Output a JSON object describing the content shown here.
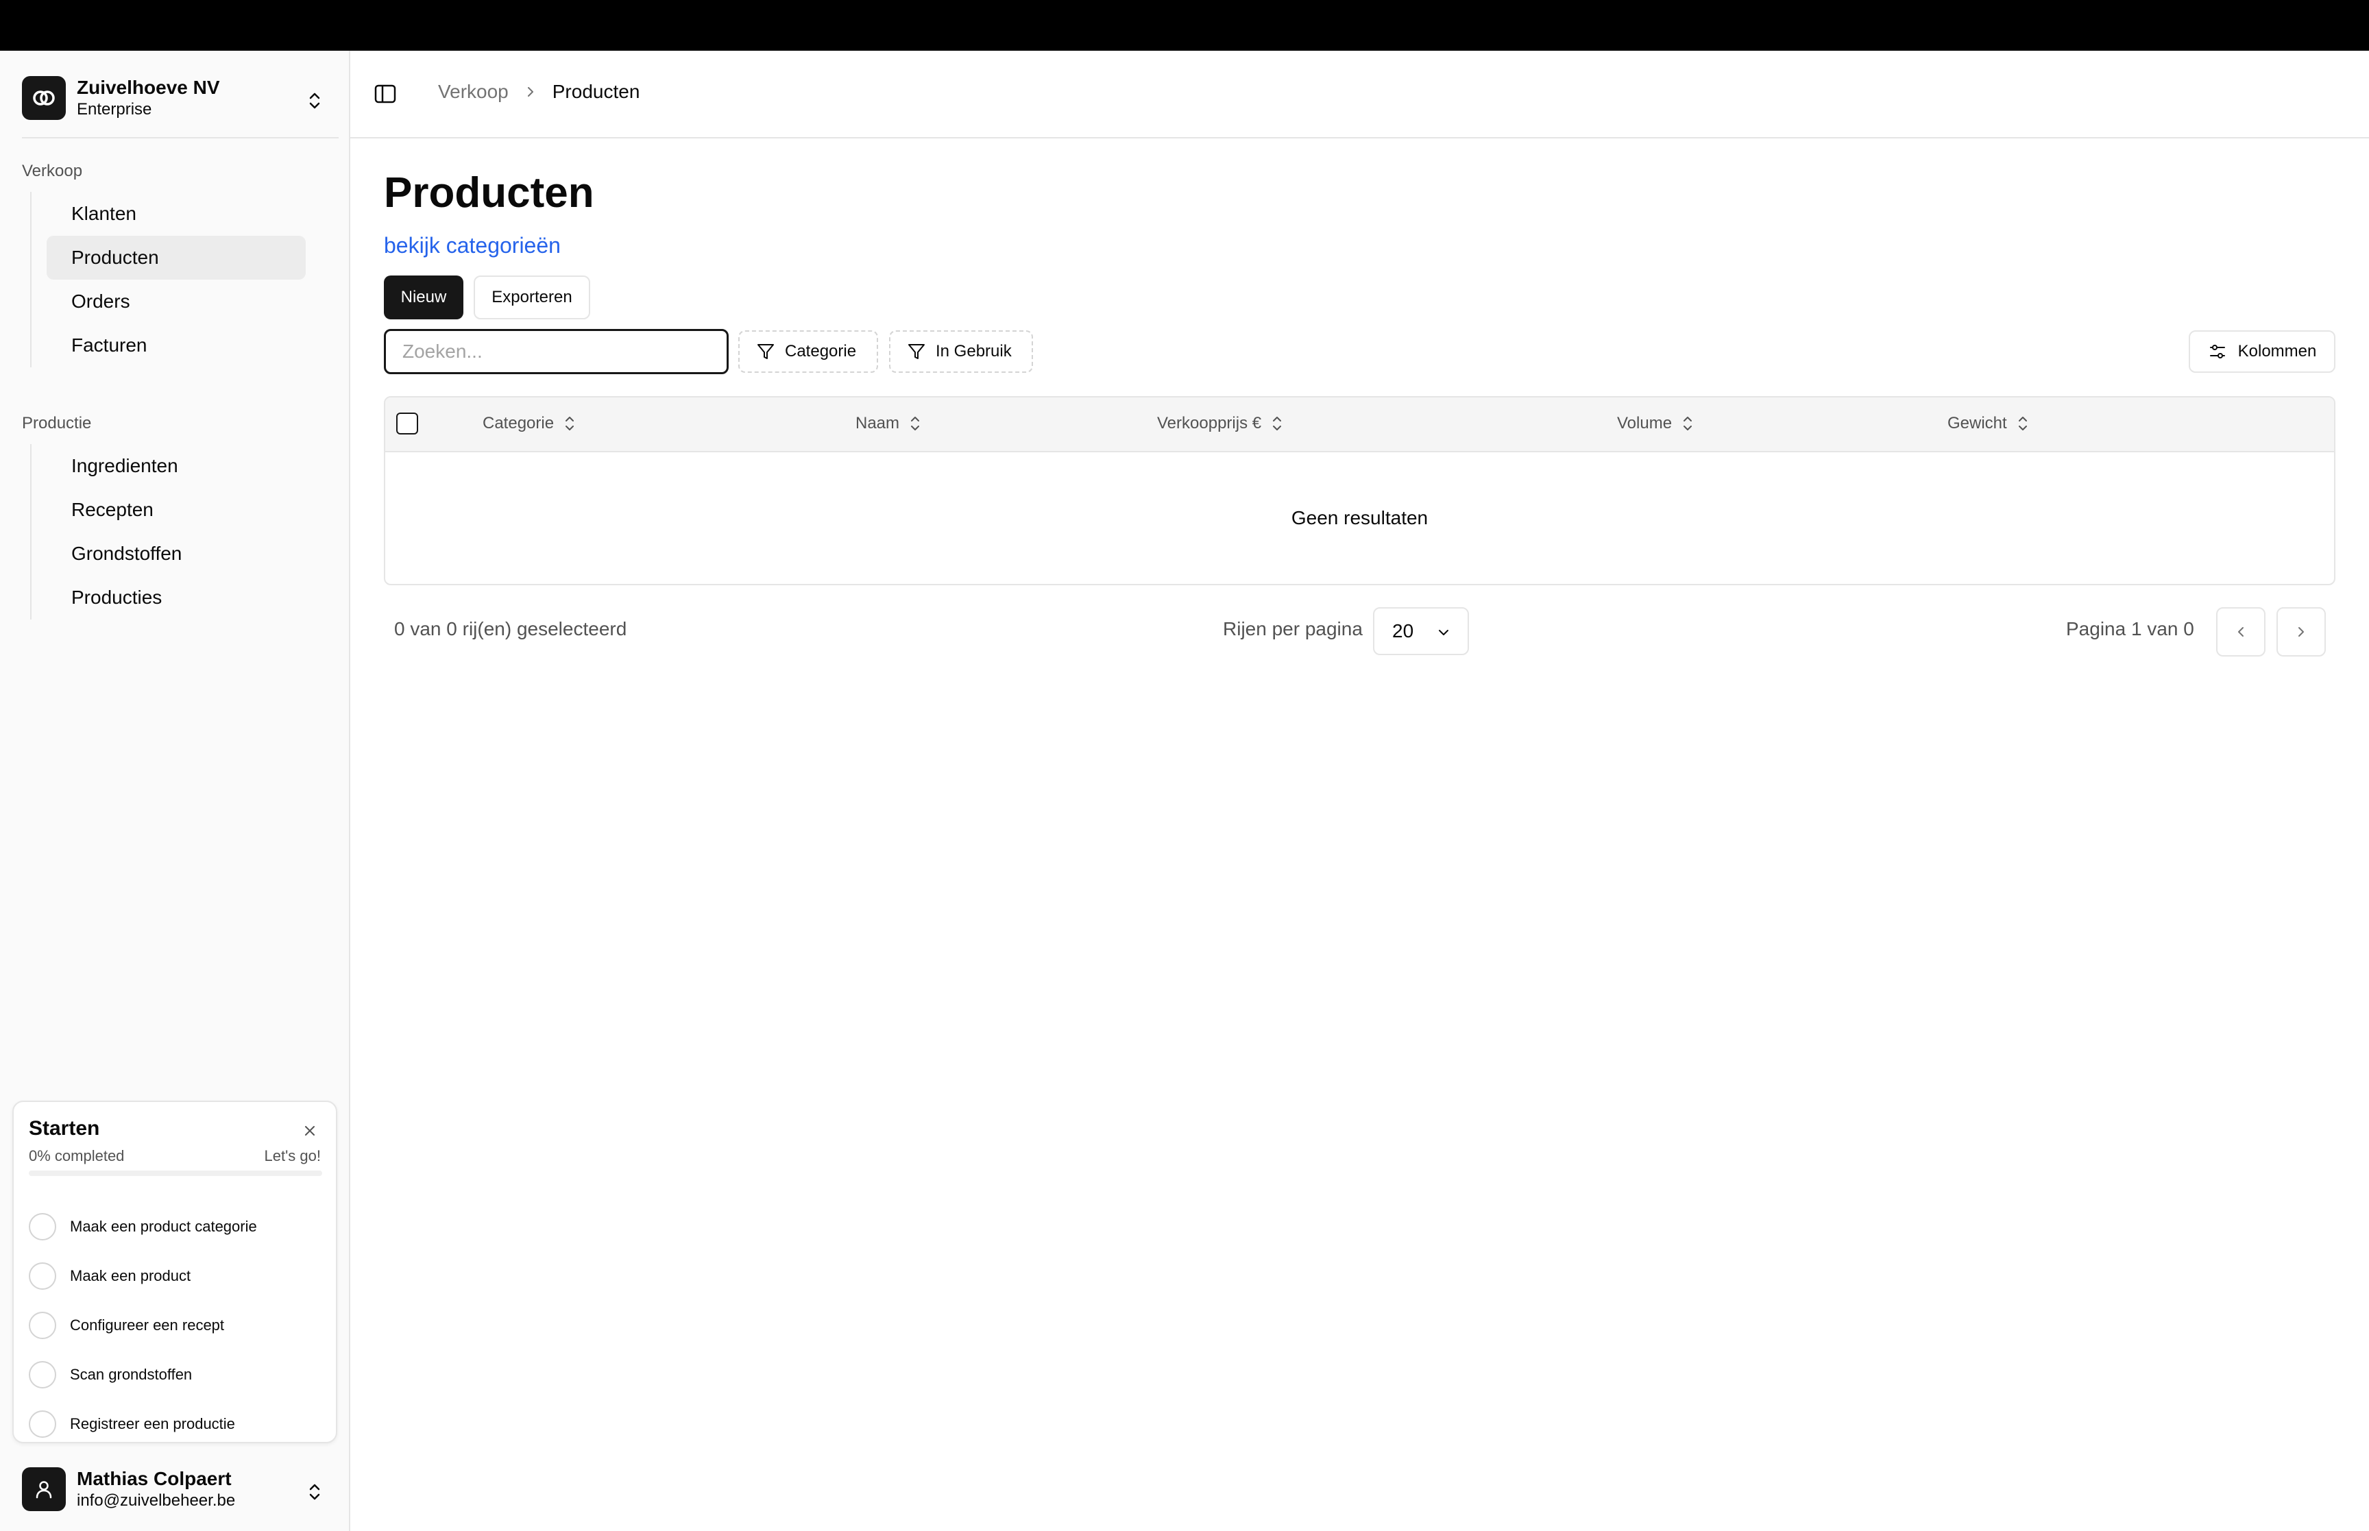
{
  "org": {
    "name": "Zuivelhoeve NV",
    "plan": "Enterprise"
  },
  "sidebar": {
    "groups": [
      {
        "label": "Verkoop",
        "items": [
          "Klanten",
          "Producten",
          "Orders",
          "Facturen"
        ]
      },
      {
        "label": "Productie",
        "items": [
          "Ingredienten",
          "Recepten",
          "Grondstoffen",
          "Producties"
        ]
      }
    ],
    "active": "Producten"
  },
  "onboarding": {
    "title": "Starten",
    "progress_text": "0% completed",
    "progress": 0,
    "cta": "Let's go!",
    "tasks": [
      "Maak een product categorie",
      "Maak een product",
      "Configureer een recept",
      "Scan grondstoffen",
      "Registreer een productie"
    ]
  },
  "user": {
    "name": "Mathias Colpaert",
    "email": "info@zuivelbeheer.be"
  },
  "breadcrumb": [
    "Verkoop",
    "Producten"
  ],
  "page": {
    "title": "Producten",
    "link": "bekijk categorieën",
    "new_label": "Nieuw",
    "export_label": "Exporteren",
    "search_placeholder": "Zoeken...",
    "filters": [
      "Categorie",
      "In Gebruik"
    ],
    "columns_label": "Kolommen"
  },
  "table": {
    "headers": [
      "Categorie",
      "Naam",
      "Verkoopprijs €",
      "Volume",
      "Gewicht"
    ],
    "empty": "Geen resultaten"
  },
  "footer": {
    "selected": "0 van 0 rij(en) geselecteerd",
    "rows_label": "Rijen per pagina",
    "rows_value": "20",
    "page_label": "Pagina 1 van 0"
  },
  "colors": {
    "accent": "#171717",
    "link": "#2563eb",
    "border": "#e5e5e5"
  },
  "icons": [
    "org-logo-icon",
    "chevrons-up-down-icon",
    "sidebar-toggle-icon",
    "chevron-right-icon",
    "filter-icon",
    "sliders-icon",
    "sort-icon",
    "chevron-down-icon",
    "chevron-left-icon",
    "close-icon",
    "user-icon"
  ]
}
